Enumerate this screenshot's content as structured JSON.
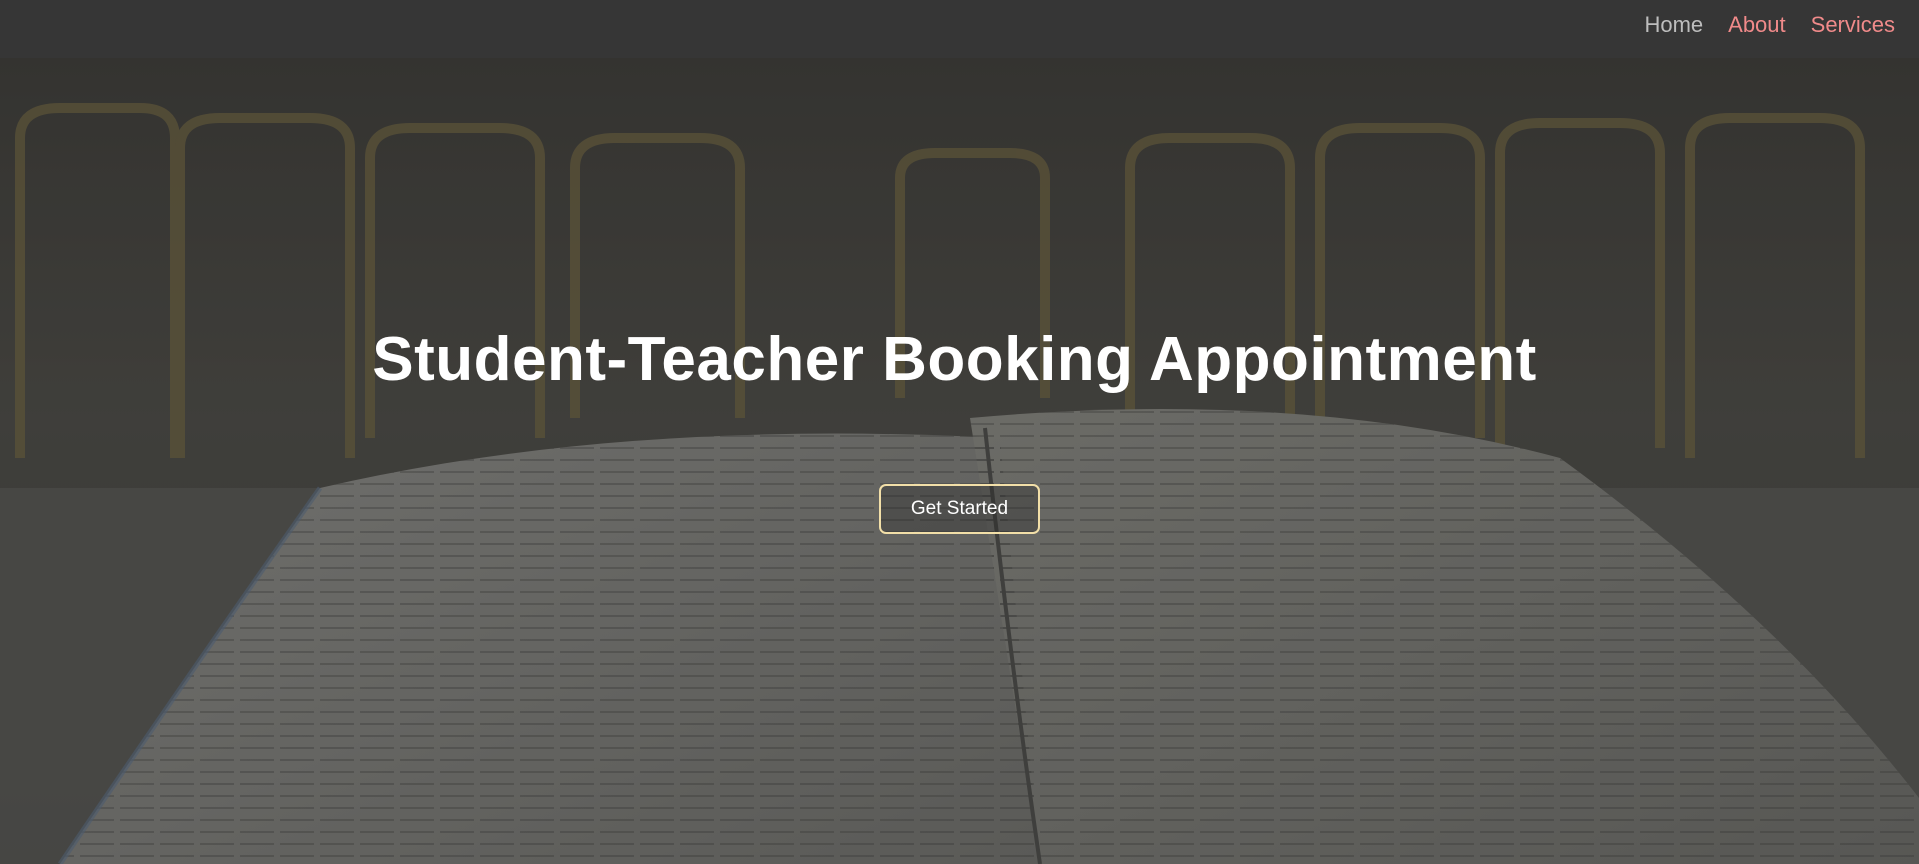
{
  "nav": {
    "links": [
      {
        "label": "Home"
      },
      {
        "label": "About"
      },
      {
        "label": "Services"
      }
    ]
  },
  "hero": {
    "title": "Student-Teacher Booking Appointment",
    "cta_label": "Get Started",
    "background_image": "open-book-on-table-classroom-chairs"
  },
  "colors": {
    "navbar_bg": "#363636",
    "nav_home": "#bdbdbd",
    "nav_accent": "#f08a8a",
    "button_border": "#f2dfa8",
    "title": "#ffffff"
  }
}
